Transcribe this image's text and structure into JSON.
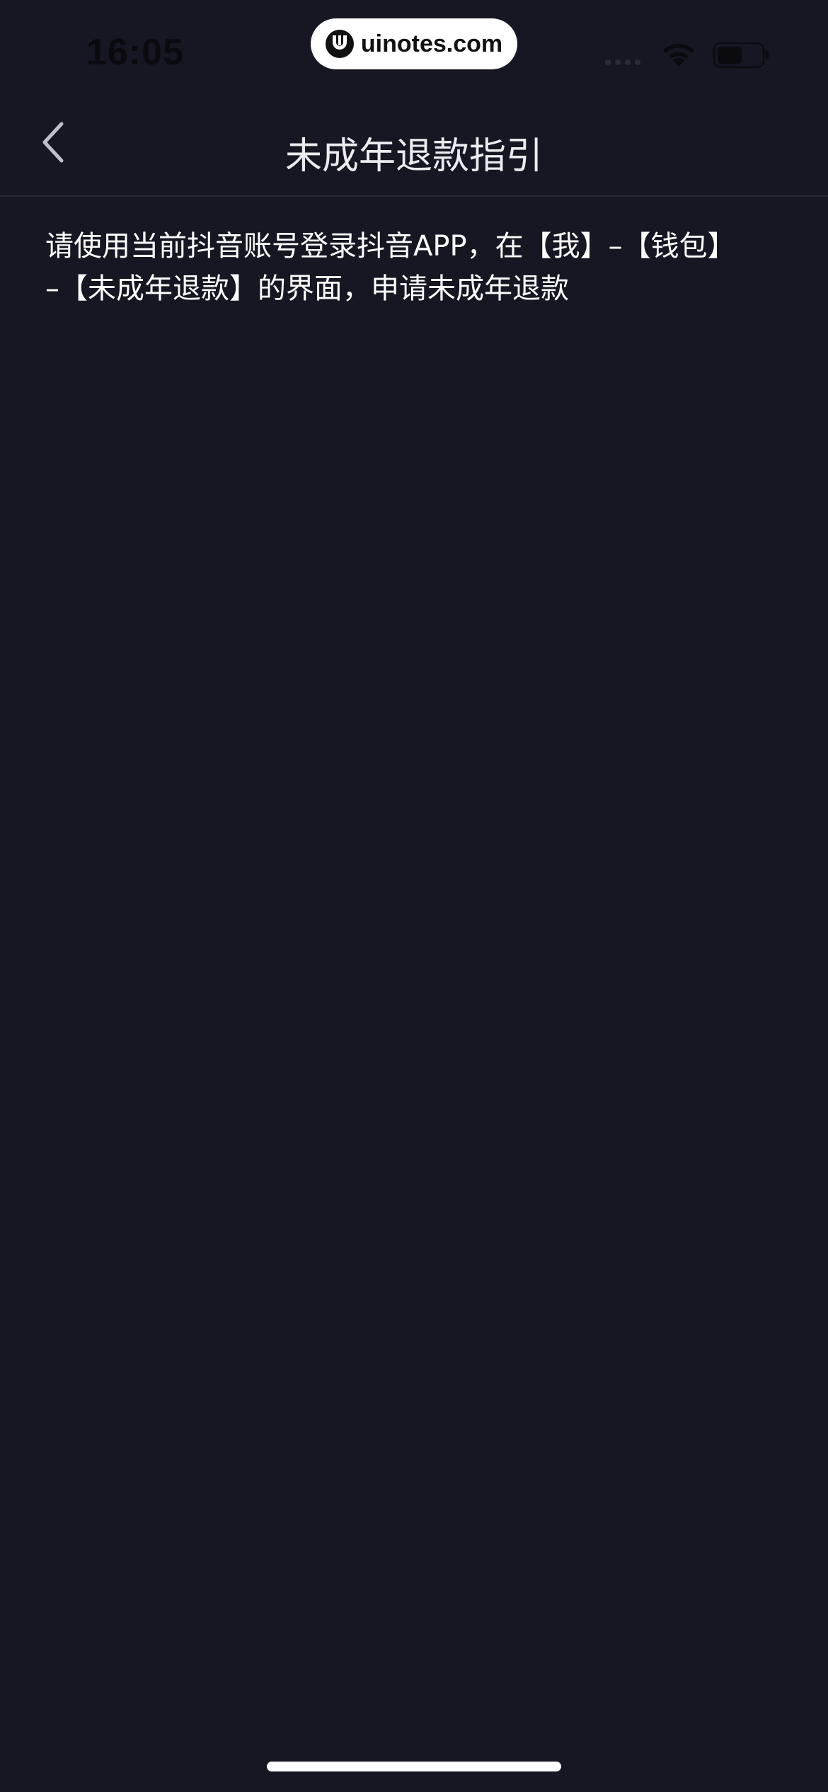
{
  "status_bar": {
    "time": "16:05",
    "watermark": "uinotes.com"
  },
  "nav": {
    "title": "未成年退款指引"
  },
  "content": {
    "guide_text": "请使用当前抖音账号登录抖音APP，在【我】–【钱包】–【未成年退款】的界面，申请未成年退款"
  },
  "colors": {
    "background": "#161722",
    "text": "#ffffff",
    "divider": "#262733"
  }
}
